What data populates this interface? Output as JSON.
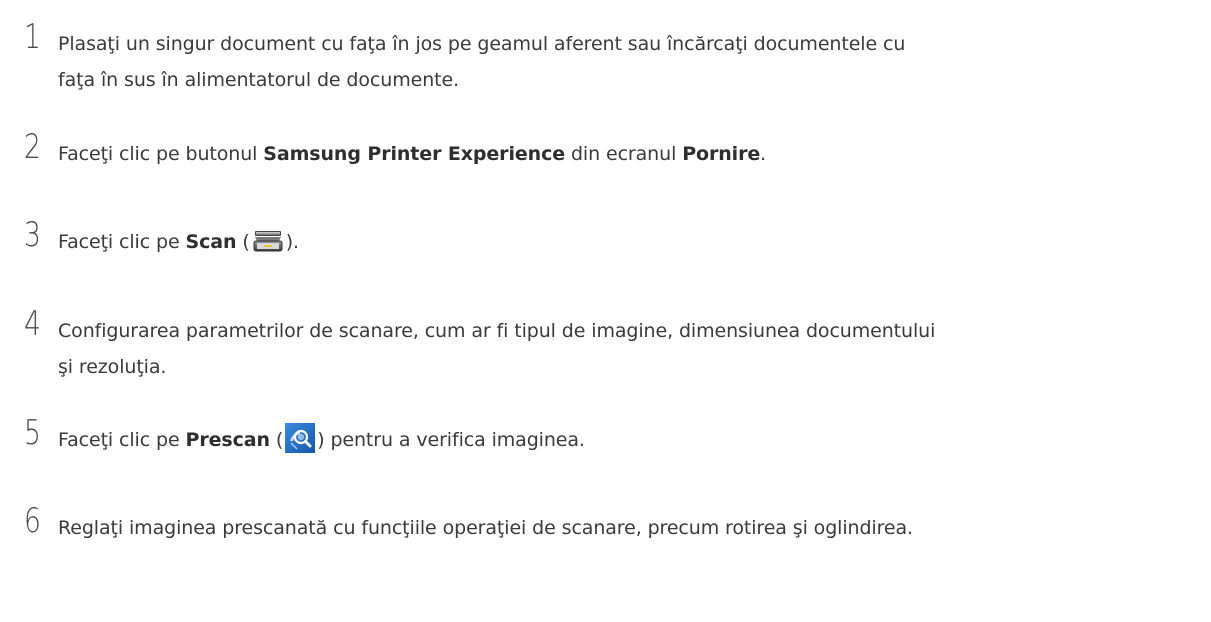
{
  "steps": [
    {
      "number": "1",
      "line1": "Plasaţi un singur document cu faţa în jos pe geamul aferent sau încărcaţi documentele cu",
      "line2": "faţa în sus în alimentatorul de documente."
    },
    {
      "number": "2",
      "pre": "Faceţi clic pe butonul ",
      "bold1": "Samsung Printer Experience",
      "mid": " din ecranul ",
      "bold2": "Pornire",
      "post": "."
    },
    {
      "number": "3",
      "pre": "Faceţi clic pe ",
      "bold": "Scan",
      "open": " (",
      "icon": "scanner-icon",
      "close": ")."
    },
    {
      "number": "4",
      "line1": "Configurarea parametrilor de scanare, cum ar fi tipul de imagine, dimensiunea documentului",
      "line2": "şi rezoluţia."
    },
    {
      "number": "5",
      "pre": "Faceţi clic pe ",
      "bold": "Prescan",
      "open": " (",
      "icon": "prescan-icon",
      "post": ") pentru a verifica imaginea."
    },
    {
      "number": "6",
      "text": "Reglaţi imaginea prescanată cu funcţiile operaţiei de scanare, precum rotirea şi oglindirea."
    }
  ],
  "colors": {
    "text": "#3a3a3a",
    "prescan_icon_bg": "#1f6fc9"
  }
}
